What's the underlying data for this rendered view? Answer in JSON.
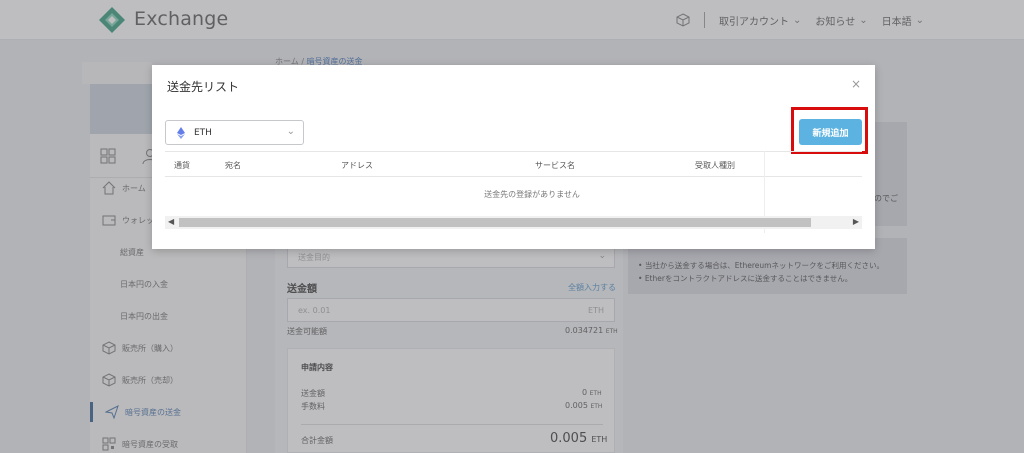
{
  "header": {
    "brand": "Exchange",
    "nav": [
      "取引アカウント",
      "お知らせ",
      "日本語"
    ]
  },
  "sidebar": {
    "items": [
      {
        "label": "ホーム"
      },
      {
        "label": "ウォレット"
      },
      {
        "label": "総資産"
      },
      {
        "label": "日本円の入金"
      },
      {
        "label": "日本円の出金"
      },
      {
        "label": "販売所（購入）"
      },
      {
        "label": "販売所（売却）"
      },
      {
        "label": "暗号資産の送金"
      },
      {
        "label": "暗号資産の受取"
      }
    ]
  },
  "breadcrumb": {
    "home": "ホーム",
    "sep": "/",
    "current": "暗号資産の送金"
  },
  "form": {
    "purpose_placeholder": "送金目的",
    "amount_label": "送金額",
    "send_all_link": "全額入力する",
    "amount_placeholder": "ex. 0.01",
    "amount_unit": "ETH",
    "available_label": "送金可能額",
    "available_value": "0.034721",
    "available_unit": "ETH"
  },
  "summary": {
    "title": "申請内容",
    "rows": [
      {
        "label": "送金額",
        "value": "0",
        "unit": "ETH"
      },
      {
        "label": "手数料",
        "value": "0.005",
        "unit": "ETH"
      }
    ],
    "total_label": "合計金額",
    "total_value": "0.005",
    "total_unit": "ETH"
  },
  "notes": {
    "fragment": "のでご",
    "line1": "当社から送金する場合は、Ethereumネットワークをご利用ください。",
    "line2": "Etherをコントラクトアドレスに送金することはできません。"
  },
  "modal": {
    "title": "送金先リスト",
    "close": "×",
    "currency_select": "ETH",
    "add_button": "新規追加",
    "columns": [
      "通貨",
      "宛名",
      "アドレス",
      "サービス名",
      "受取人種別"
    ],
    "empty_message": "送金先の登録がありません"
  },
  "colors": {
    "accent": "#5cb2e0",
    "highlight": "#d80c0c",
    "brand_green": "#2f9a7a"
  }
}
